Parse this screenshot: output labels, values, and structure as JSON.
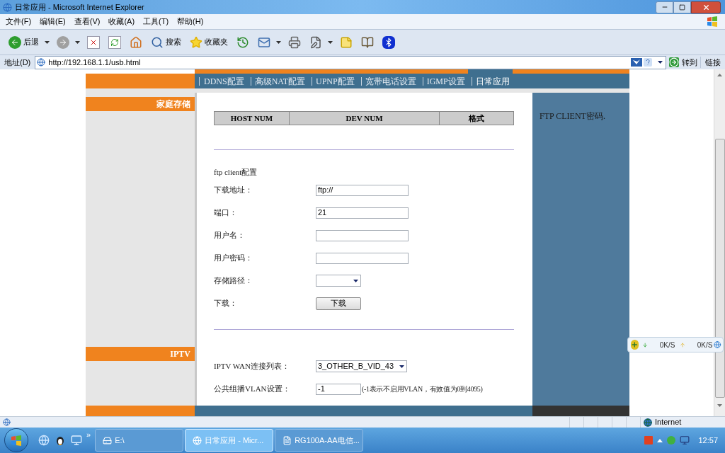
{
  "window": {
    "title": "日常应用 - Microsoft Internet Explorer"
  },
  "menu": [
    "文件(F)",
    "编辑(E)",
    "查看(V)",
    "收藏(A)",
    "工具(T)",
    "帮助(H)"
  ],
  "toolbar": [
    {
      "kind": "back",
      "label": "后退"
    },
    {
      "kind": "forward"
    },
    {
      "kind": "stop"
    },
    {
      "kind": "refresh"
    },
    {
      "kind": "home"
    },
    {
      "kind": "search",
      "label": "搜索"
    },
    {
      "kind": "favorites",
      "label": "收藏夹"
    },
    {
      "kind": "history"
    },
    {
      "kind": "mail"
    },
    {
      "kind": "print"
    },
    {
      "kind": "edit"
    },
    {
      "kind": "note"
    },
    {
      "kind": "research"
    },
    {
      "kind": "bluetooth"
    }
  ],
  "address": {
    "label": "地址(D)",
    "value": "http://192.168.1.1/usb.html",
    "go": "转到",
    "links": "链接"
  },
  "nav_tabs": [
    {
      "label": "DDNS配置",
      "selected": false
    },
    {
      "label": "高级NAT配置",
      "selected": false
    },
    {
      "label": "UPNP配置",
      "selected": false
    },
    {
      "label": "宽带电话设置",
      "selected": false
    },
    {
      "label": "IGMP设置",
      "selected": false
    },
    {
      "label": "日常应用",
      "selected": true
    }
  ],
  "sidebar": [
    "家庭存储",
    "IPTV"
  ],
  "storage_table": {
    "columns": [
      "HOST NUM",
      "DEV NUM",
      "格式"
    ]
  },
  "ftp": {
    "title": "ftp client配置",
    "fields": [
      {
        "kind": "text",
        "label": "下载地址：",
        "value": "ftp://"
      },
      {
        "kind": "text",
        "label": "端口：",
        "value": "21"
      },
      {
        "kind": "text",
        "label": "用户名："
      },
      {
        "kind": "password",
        "label": "用户密码："
      },
      {
        "kind": "select",
        "label": "存储路径："
      },
      {
        "kind": "button",
        "label": "下载：",
        "button": "下载"
      }
    ]
  },
  "iptv": {
    "fields": [
      {
        "kind": "select",
        "label": "IPTV WAN连接列表：",
        "value": "3_OTHER_B_VID_43"
      },
      {
        "kind": "text",
        "label": "公共组播VLAN设置：",
        "value": "-1",
        "note": "(-1表示不启用VLAN，有效值为0到4095)"
      }
    ]
  },
  "help": "FTP CLIENT密码.",
  "speed_widget": {
    "down": "0K/S",
    "up": "0K/S"
  },
  "status_bar": {
    "zone": "Internet"
  },
  "taskbar": {
    "more": "»",
    "items": [
      {
        "label": "E:\\",
        "selected": false
      },
      {
        "label": "日常应用 - Micr...",
        "selected": true
      },
      {
        "label": "RG100A-AA电信...",
        "selected": false
      }
    ],
    "clock": "12:57"
  }
}
